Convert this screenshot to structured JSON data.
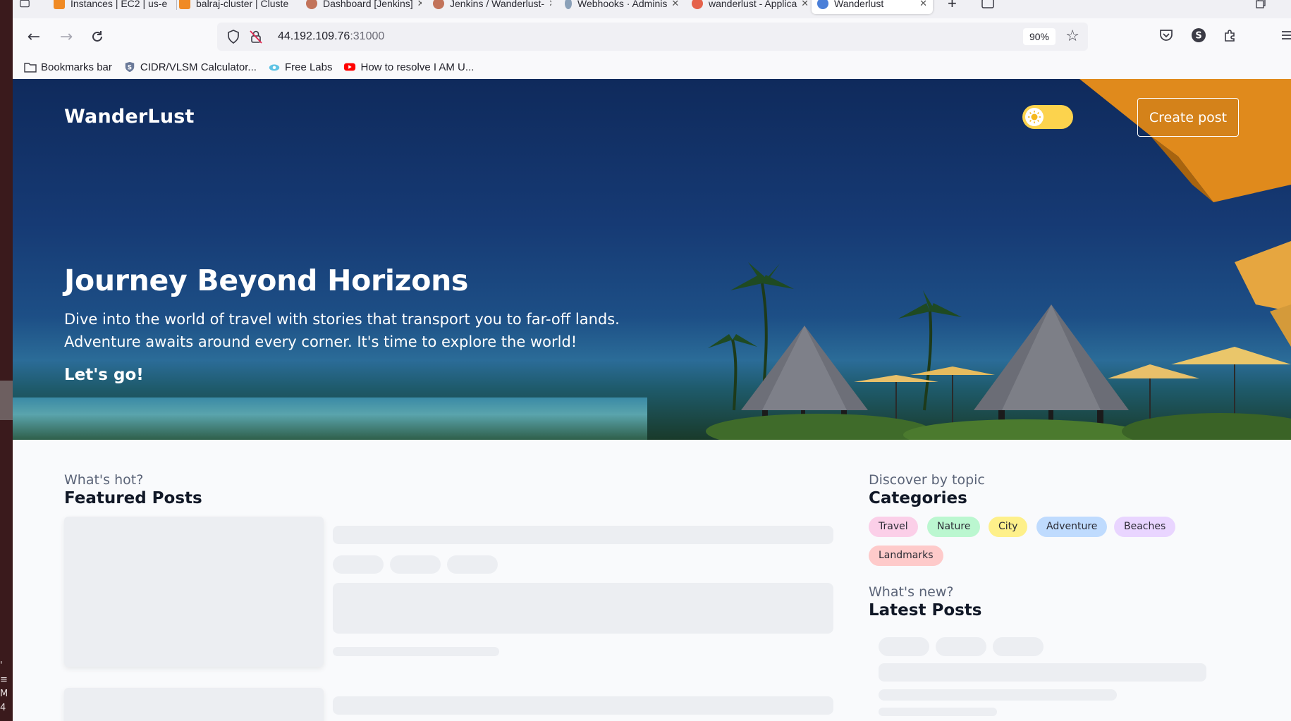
{
  "tabs": [
    {
      "label": "Instances | EC2 | us-e",
      "favicon_color": "#f08a24"
    },
    {
      "label": "balraj-cluster | Cluste",
      "favicon_color": "#f08a24"
    },
    {
      "label": "Dashboard [Jenkins]",
      "favicon_color": "#c2735a"
    },
    {
      "label": "Jenkins / Wanderlust-",
      "favicon_color": "#c2735a"
    },
    {
      "label": "Webhooks · Adminis",
      "favicon_color": "#8aa0b8"
    },
    {
      "label": "wanderlust - Applica",
      "favicon_color": "#e5624b"
    },
    {
      "label": "Wanderlust",
      "favicon_color": "#4a7fd8"
    }
  ],
  "address": {
    "host": "44.192.109.76",
    "port": ":31000",
    "zoom": "90%"
  },
  "bookmarks": [
    {
      "label": "Bookmarks bar",
      "icon": "folder-icon"
    },
    {
      "label": "CIDR/VLSM Calculator...",
      "icon": "shield-s-icon"
    },
    {
      "label": "Free Labs",
      "icon": "cloud-icon"
    },
    {
      "label": "How to resolve I AM U...",
      "icon": "youtube-icon"
    }
  ],
  "header": {
    "brand": "WanderLust",
    "create_post": "Create post"
  },
  "hero": {
    "title": "Journey Beyond Horizons",
    "description": "Dive into the world of travel with stories that transport you to far-off lands. Adventure awaits around every corner. It's time to explore the world!",
    "cta": "Let's go!"
  },
  "featured": {
    "subtitle": "What's hot?",
    "title": "Featured Posts"
  },
  "categories": {
    "subtitle": "Discover by topic",
    "title": "Categories",
    "items": [
      {
        "label": "Travel",
        "color": "#fbcfe8"
      },
      {
        "label": "Nature",
        "color": "#bbf7d0"
      },
      {
        "label": "City",
        "color": "#fef08a"
      },
      {
        "label": "Adventure",
        "color": "#bfdbfe"
      },
      {
        "label": "Beaches",
        "color": "#e9d5ff"
      },
      {
        "label": "Landmarks",
        "color": "#fecaca"
      }
    ]
  },
  "latest": {
    "subtitle": "What's new?",
    "title": "Latest Posts"
  },
  "desktop_strip": {
    "chars": [
      "'",
      "≡",
      "M",
      "4"
    ]
  },
  "colors": {
    "hero_bg": "#163a74",
    "toggle": "#fcd34d",
    "skeleton": "#eceef2"
  }
}
